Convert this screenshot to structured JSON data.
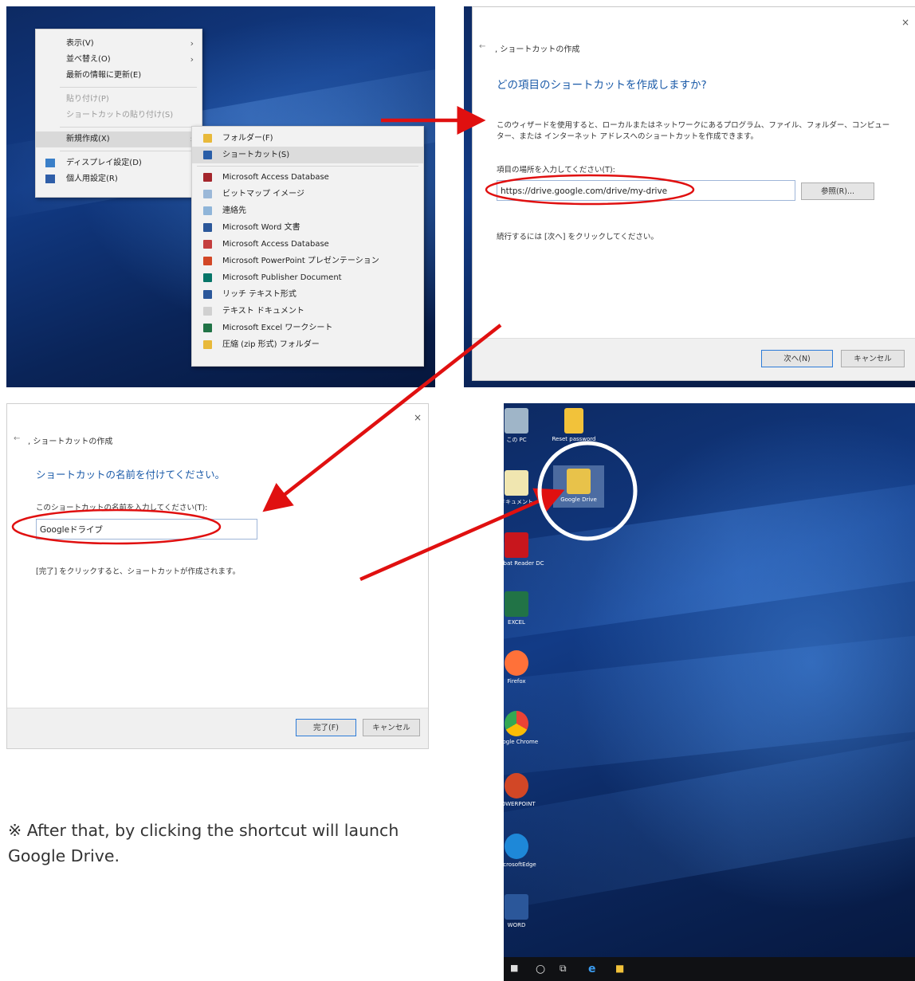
{
  "context_menu": {
    "items": [
      {
        "label": "表示(V)",
        "arrow": true,
        "disabled": false
      },
      {
        "label": "並べ替え(O)",
        "arrow": true,
        "disabled": false
      },
      {
        "label": "最新の情報に更新(E)",
        "arrow": false,
        "disabled": false
      },
      {
        "label": "貼り付け(P)",
        "arrow": false,
        "disabled": true
      },
      {
        "label": "ショートカットの貼り付け(S)",
        "arrow": false,
        "disabled": true
      },
      {
        "label": "新規作成(X)",
        "arrow": true,
        "disabled": false,
        "highlighted": true
      },
      {
        "label": "ディスプレイ設定(D)",
        "icon": "display-settings-icon"
      },
      {
        "label": "個人用設定(R)",
        "icon": "personalize-icon"
      }
    ]
  },
  "new_submenu": {
    "items": [
      {
        "label": "フォルダー(F)",
        "icon": "folder-icon",
        "color": "#e8b93a"
      },
      {
        "label": "ショートカット(S)",
        "icon": "shortcut-icon",
        "color": "#2a5ea8",
        "highlighted": true
      },
      {
        "label": "Microsoft Access Database",
        "icon": "access-icon",
        "color": "#a4262c"
      },
      {
        "label": "ビットマップ イメージ",
        "icon": "bitmap-icon",
        "color": "#9bb8d8"
      },
      {
        "label": "連絡先",
        "icon": "contact-icon",
        "color": "#8fb5d9"
      },
      {
        "label": "Microsoft Word 文書",
        "icon": "word-icon",
        "color": "#2b579a"
      },
      {
        "label": "Microsoft Access Database",
        "icon": "access-icon",
        "color": "#c43e3e"
      },
      {
        "label": "Microsoft PowerPoint プレゼンテーション",
        "icon": "powerpoint-icon",
        "color": "#d24726"
      },
      {
        "label": "Microsoft Publisher Document",
        "icon": "publisher-icon",
        "color": "#077568"
      },
      {
        "label": "リッチ テキスト形式",
        "icon": "rtf-icon",
        "color": "#2b579a"
      },
      {
        "label": "テキスト ドキュメント",
        "icon": "text-doc-icon",
        "color": "#d0d0d0"
      },
      {
        "label": "Microsoft Excel ワークシート",
        "icon": "excel-icon",
        "color": "#217346"
      },
      {
        "label": "圧縮 (zip 形式) フォルダー",
        "icon": "zip-folder-icon",
        "color": "#e8b93a"
      }
    ]
  },
  "wizard1": {
    "close": "×",
    "back": "←",
    "header": "ショートカットの作成",
    "title": "どの項目のショートカットを作成しますか?",
    "description": "このウィザードを使用すると、ローカルまたはネットワークにあるプログラム、ファイル、フォルダー、コンピューター、または インターネット アドレスへのショートカットを作成できます。",
    "field_label": "項目の場所を入力してください(T):",
    "field_value": "https://drive.google.com/drive/my-drive",
    "browse": "参照(R)...",
    "continue_text": "続行するには [次へ] をクリックしてください。",
    "next": "次へ(N)",
    "cancel": "キャンセル"
  },
  "wizard2": {
    "close": "×",
    "back": "←",
    "header": "ショートカットの作成",
    "title": "ショートカットの名前を付けてください。",
    "field_label": "このショートカットの名前を入力してください(T):",
    "field_value": "Googleドライブ",
    "finish_text": "[完了] をクリックすると、ショートカットが作成されます。",
    "finish": "完了(F)",
    "cancel": "キャンセル"
  },
  "desktop": {
    "icons": [
      {
        "label": "この PC",
        "color": "#9fb5c8"
      },
      {
        "label": "Reset password",
        "color": "#f2c23a"
      },
      {
        "label": "ドキュメント",
        "color": "#f0e6b0"
      },
      {
        "label": "Google Drive",
        "color": "#e8c24a"
      },
      {
        "label": "Acrobat Reader DC",
        "color": "#c8161d"
      },
      {
        "label": "EXCEL",
        "color": "#217346"
      },
      {
        "label": "Firefox",
        "color": "#ff7139"
      },
      {
        "label": "Google Chrome",
        "color": "#34a853"
      },
      {
        "label": "POWERPOINT",
        "color": "#d24726"
      },
      {
        "label": "MicrosoftEdge",
        "color": "#1e88d8"
      },
      {
        "label": "WORD",
        "color": "#2b579a"
      }
    ]
  },
  "note": "※ After that, by clicking the shortcut will launch Google Drive.",
  "colors": {
    "arrow": "#e01010",
    "highlight_circle": "#ffffff",
    "wizard_title": "#1a5aa8"
  }
}
